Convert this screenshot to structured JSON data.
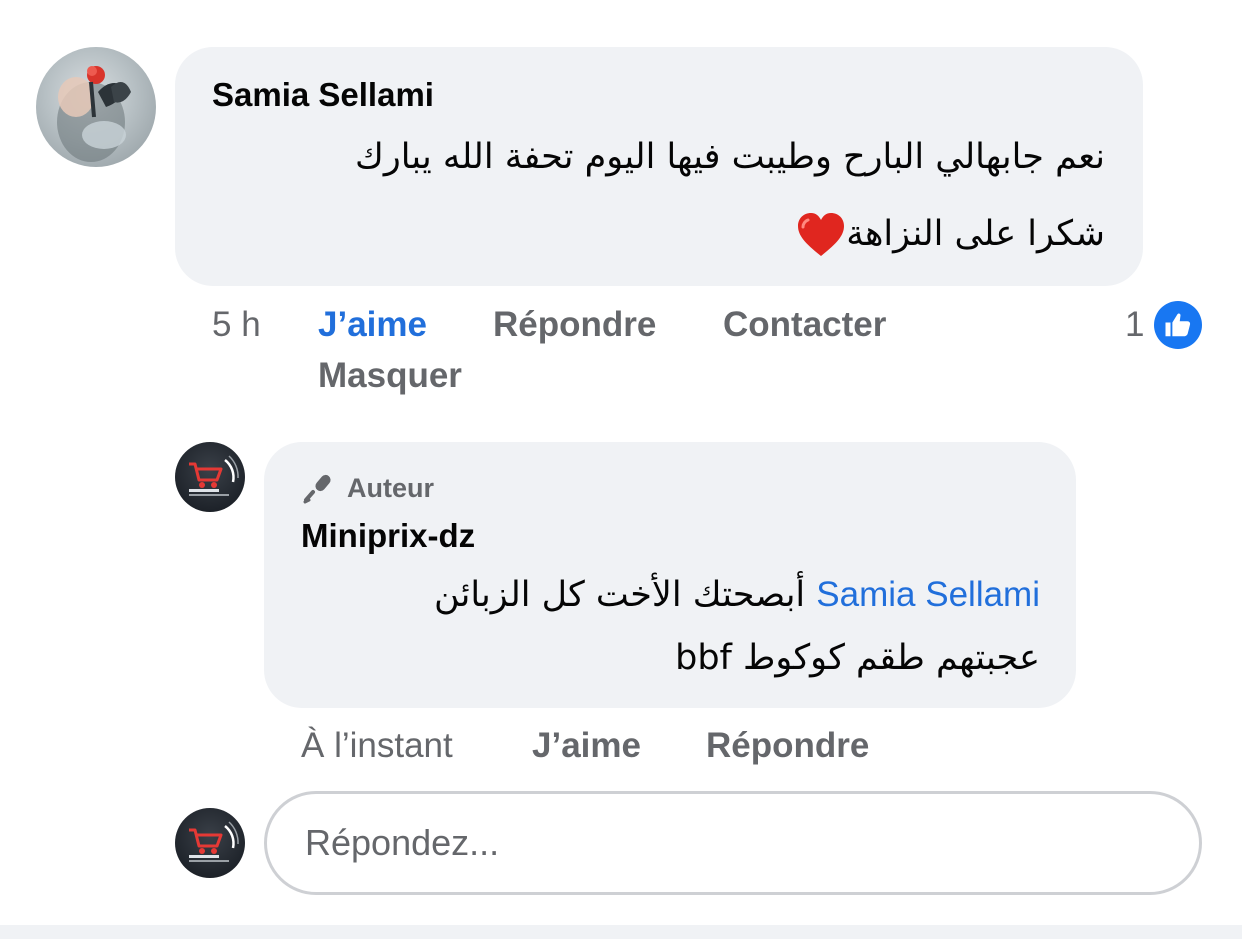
{
  "comment": {
    "author": "Samia Sellami",
    "lines": [
      "نعم جابهالي البارح وطيبت فيها اليوم تحفة الله يبارك",
      "شكرا على النزاهة"
    ],
    "heart_icon": "red-heart-emoji",
    "time": "5 h",
    "actions": {
      "like": "J’aime",
      "reply": "Répondre",
      "contact": "Contacter",
      "hide": "Masquer"
    },
    "reaction_count": "1",
    "reaction_icon": "like-thumb-icon"
  },
  "reply": {
    "badge": "Auteur",
    "badge_icon": "microphone-icon",
    "author": "Miniprix-dz",
    "mention": "Samia Sellami",
    "line1_text": " أبصحتك الأخت كل الزبائن",
    "line2": "عجبتهم  طقم كوكوط bbf",
    "time": "À l’instant",
    "actions": {
      "like": "J’aime",
      "reply": "Répondre"
    }
  },
  "reply_box": {
    "placeholder": "Répondez..."
  },
  "colors": {
    "accent": "#216fdb",
    "bubble": "#f0f2f5",
    "secondary_text": "#65676b",
    "like_badge": "#1877f2"
  }
}
